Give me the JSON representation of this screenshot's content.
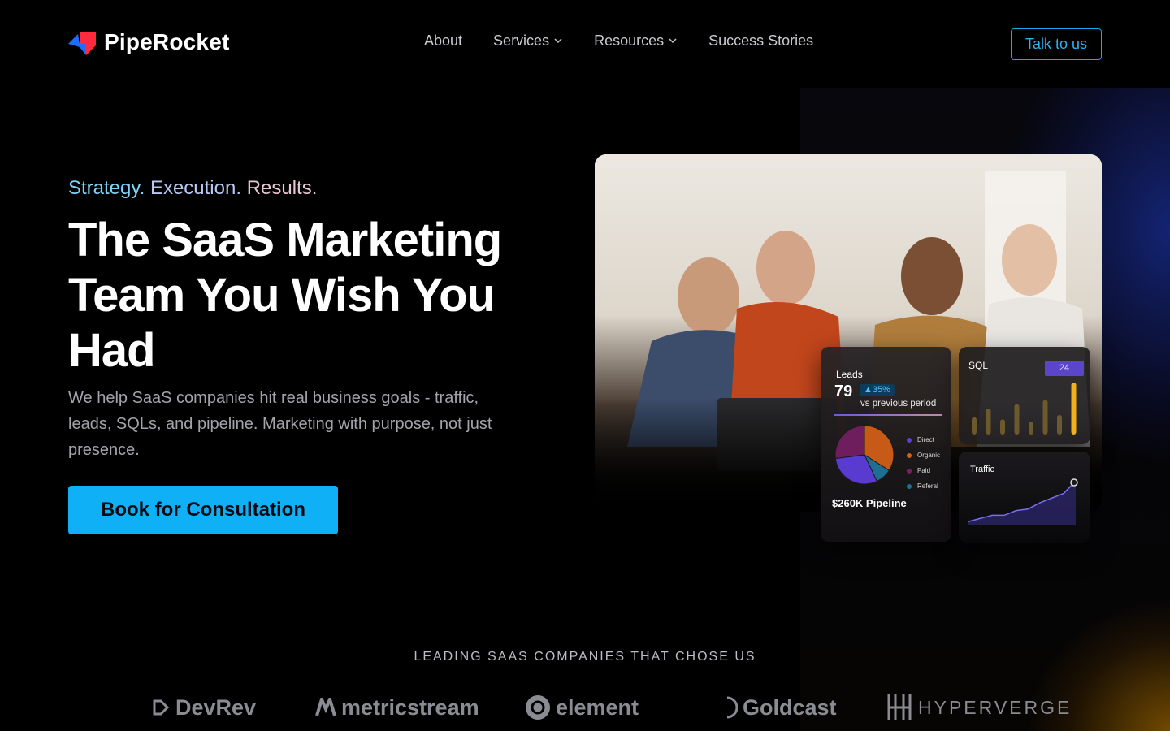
{
  "brand": {
    "name": "PipeRocket",
    "accent": "#10b0f7",
    "logo_colors": [
      "#1f6dff",
      "#ff2b3d"
    ]
  },
  "nav": {
    "items": [
      {
        "label": "About",
        "has_dropdown": false
      },
      {
        "label": "Services",
        "has_dropdown": true
      },
      {
        "label": "Resources",
        "has_dropdown": true
      },
      {
        "label": "Success Stories",
        "has_dropdown": false
      }
    ],
    "cta_label": "Talk to us"
  },
  "hero": {
    "tagline": [
      "Strategy.",
      "Execution.",
      "Results."
    ],
    "headline": "The SaaS Marketing Team You Wish You Had",
    "subcopy": "We help SaaS companies hit real business goals - traffic, leads, SQLs, and pipeline. Marketing with purpose, not just presence.",
    "cta_label": "Book for Consultation"
  },
  "dashboard": {
    "leads": {
      "title": "Leads",
      "value": "79",
      "change": "▲35%",
      "comparison": "vs previous period",
      "pipeline": "$260K Pipeline",
      "legend": [
        {
          "label": "Direct",
          "color": "#5c3fd6"
        },
        {
          "label": "Organic",
          "color": "#d0631c"
        },
        {
          "label": "Paid",
          "color": "#7a1f63"
        },
        {
          "label": "Referal",
          "color": "#1e6f94"
        }
      ],
      "pie": [
        {
          "label": "Organic",
          "value": 34,
          "color": "#c85a18"
        },
        {
          "label": "Referal",
          "value": 9,
          "color": "#1e6f94"
        },
        {
          "label": "Direct",
          "value": 30,
          "color": "#5a3bd0"
        },
        {
          "label": "Paid",
          "value": 27,
          "color": "#6e1d5d"
        }
      ]
    },
    "sql": {
      "title": "SQL",
      "badge": "24",
      "bars": [
        8,
        12,
        7,
        14,
        6,
        16,
        9,
        24
      ]
    },
    "traffic": {
      "title": "Traffic",
      "series": [
        2,
        4,
        6,
        6,
        9,
        10,
        14,
        17,
        20,
        28
      ]
    }
  },
  "logos": {
    "title": "LEADING SAAS COMPANIES THAT CHOSE US",
    "items": [
      {
        "name": "DevRev",
        "icon": "devrev-icon"
      },
      {
        "name": "metricstream",
        "icon": "metricstream-icon"
      },
      {
        "name": "element",
        "icon": "element-icon"
      },
      {
        "name": "Goldcast",
        "icon": "goldcast-icon"
      },
      {
        "name": "HYPERVERGE",
        "icon": "hyperverge-icon"
      }
    ]
  }
}
